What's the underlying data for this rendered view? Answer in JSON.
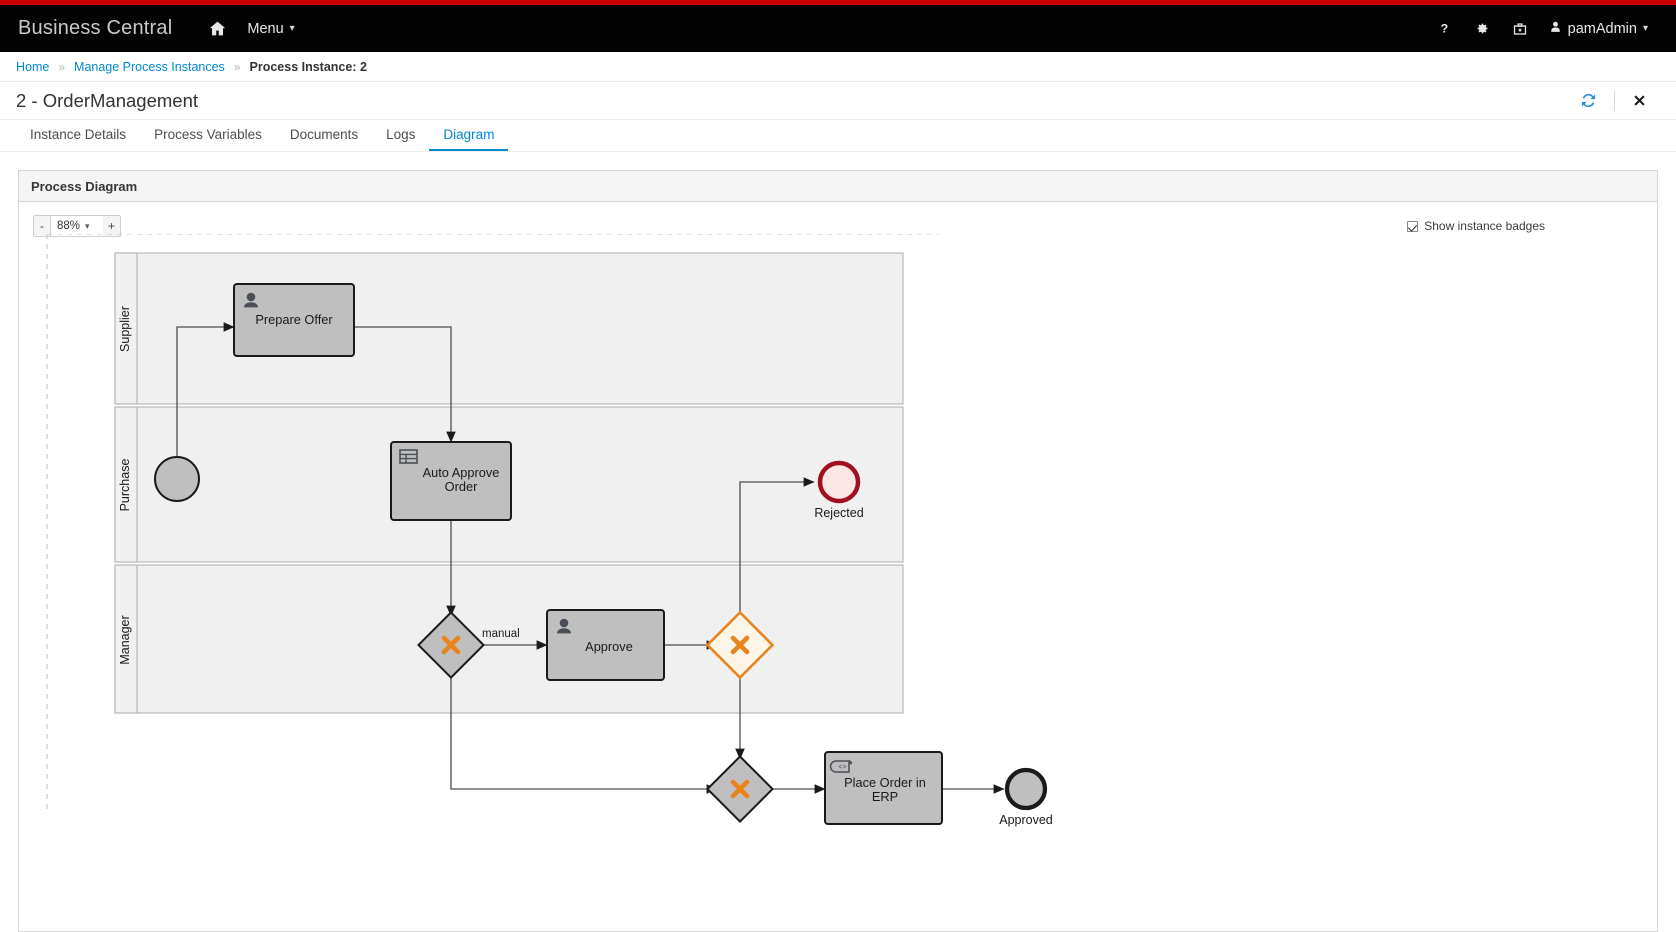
{
  "masthead": {
    "brand": "Business Central",
    "home_icon": "home-icon",
    "menu_label": "Menu",
    "help_icon": "question-mark-icon",
    "settings_icon": "gear-icon",
    "toolbox_icon": "briefcase-icon",
    "user_icon": "user-icon",
    "user_name": "pamAdmin",
    "accent_color": "#cc0000",
    "bar_color": "#030303"
  },
  "breadcrumb": {
    "items": [
      {
        "label": "Home",
        "link": true
      },
      {
        "label": "Manage Process Instances",
        "link": true
      },
      {
        "label": "Process Instance: 2",
        "link": false
      }
    ],
    "separator": "»"
  },
  "page": {
    "title": "2 - OrderManagement",
    "refresh_icon": "refresh-icon",
    "close_icon": "close-icon",
    "refresh_color": "#2c8ad8"
  },
  "tabs": [
    {
      "label": "Instance Details",
      "active": false
    },
    {
      "label": "Process Variables",
      "active": false
    },
    {
      "label": "Documents",
      "active": false
    },
    {
      "label": "Logs",
      "active": false
    },
    {
      "label": "Diagram",
      "active": true
    }
  ],
  "panel": {
    "title": "Process Diagram"
  },
  "toolbar": {
    "zoom_out_label": "-",
    "zoom_value": "88%",
    "zoom_in_label": "+",
    "zoom_caret": "⌄",
    "badges_label": "Show instance badges",
    "badges_checked": true
  },
  "diagram": {
    "lanes": [
      {
        "id": "supplier",
        "label": "Supplier"
      },
      {
        "id": "purchase",
        "label": "Purchase"
      },
      {
        "id": "manager",
        "label": "Manager"
      }
    ],
    "nodes": [
      {
        "id": "start",
        "type": "start-event",
        "label": "",
        "lane": "purchase"
      },
      {
        "id": "prepare",
        "type": "user-task",
        "label": "Prepare Offer",
        "lane": "supplier",
        "icon": "user-icon"
      },
      {
        "id": "autoapprove",
        "type": "business-rule-task",
        "label": "Auto Approve Order",
        "lane": "purchase",
        "icon": "table-icon"
      },
      {
        "id": "gw1",
        "type": "exclusive-gateway",
        "label": "",
        "lane": "manager",
        "state": "completed"
      },
      {
        "id": "approve",
        "type": "user-task",
        "label": "Approve",
        "lane": "manager",
        "icon": "user-icon"
      },
      {
        "id": "gw2",
        "type": "exclusive-gateway",
        "label": "",
        "lane": "manager",
        "state": "active"
      },
      {
        "id": "rejected",
        "type": "end-event",
        "label": "Rejected",
        "lane": "purchase",
        "state": "error"
      },
      {
        "id": "gw3",
        "type": "exclusive-gateway",
        "label": "",
        "lane": "none",
        "state": "completed"
      },
      {
        "id": "placeorder",
        "type": "script-task",
        "label": "Place Order in ERP",
        "lane": "none",
        "icon": "script-icon"
      },
      {
        "id": "approved",
        "type": "end-event",
        "label": "Approved",
        "lane": "none",
        "state": "completed"
      }
    ],
    "edges": [
      {
        "from": "start",
        "to": "prepare",
        "label": ""
      },
      {
        "from": "prepare",
        "to": "autoapprove",
        "label": ""
      },
      {
        "from": "autoapprove",
        "to": "gw1",
        "label": ""
      },
      {
        "from": "gw1",
        "to": "approve",
        "label": "manual"
      },
      {
        "from": "gw1",
        "to": "gw3",
        "label": ""
      },
      {
        "from": "approve",
        "to": "gw2",
        "label": ""
      },
      {
        "from": "gw2",
        "to": "rejected",
        "label": ""
      },
      {
        "from": "gw2",
        "to": "gw3",
        "label": ""
      },
      {
        "from": "gw3",
        "to": "placeorder",
        "label": ""
      },
      {
        "from": "placeorder",
        "to": "approved",
        "label": ""
      }
    ],
    "labels": {
      "prepare": "Prepare Offer",
      "autoapprove_line1": "Auto Approve",
      "autoapprove_line2": "Order",
      "approve": "Approve",
      "placeorder_line1": "Place Order in",
      "placeorder_line2": "ERP",
      "rejected": "Rejected",
      "approved": "Approved",
      "edge_manual": "manual"
    },
    "colors": {
      "node_fill": "#bfbfbf",
      "node_stroke": "#1a1a1a",
      "lane_fill": "#f0f0f0",
      "lane_stroke": "#b3b3b3",
      "active_stroke": "#e8841a",
      "active_fill": "#fdf5e8",
      "error_stroke": "#a01020",
      "error_fill": "#fbe5e5",
      "edge_stroke": "#4d4d4d"
    }
  }
}
